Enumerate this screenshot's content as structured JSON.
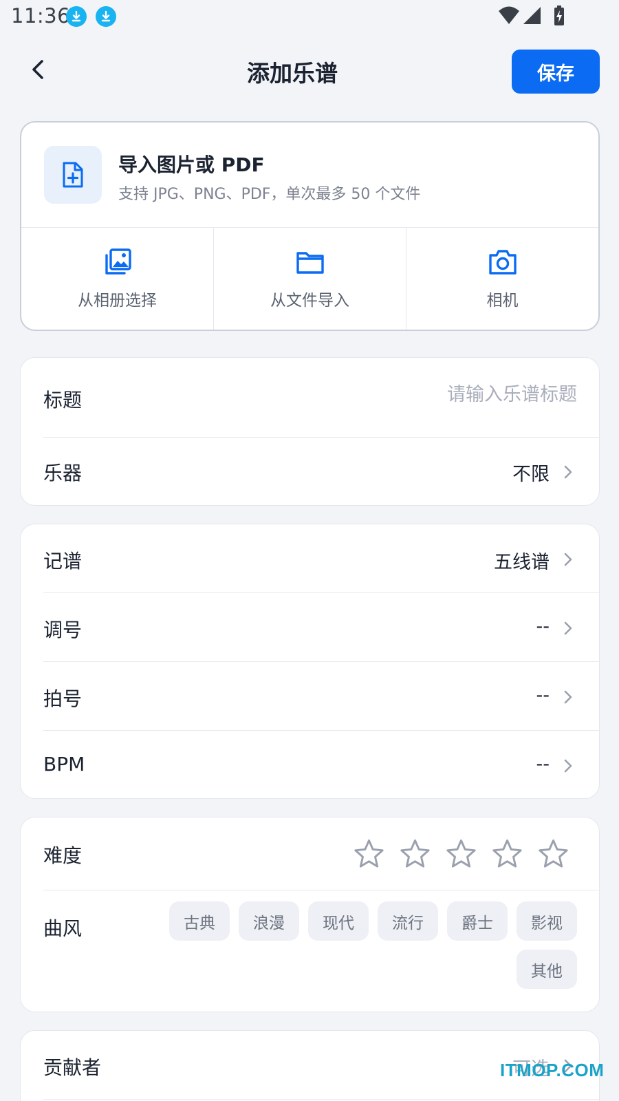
{
  "status_bar": {
    "time": "11:36"
  },
  "header": {
    "title": "添加乐谱",
    "save_label": "保存"
  },
  "import": {
    "title": "导入图片或 PDF",
    "subtitle": "支持 JPG、PNG、PDF，单次最多 50 个文件",
    "actions": [
      {
        "label": "从相册选择",
        "icon": "gallery-icon"
      },
      {
        "label": "从文件导入",
        "icon": "folder-icon"
      },
      {
        "label": "相机",
        "icon": "camera-icon"
      }
    ]
  },
  "basic": {
    "title_label": "标题",
    "title_placeholder": "请输入乐谱标题",
    "instrument_label": "乐器",
    "instrument_value": "不限"
  },
  "notation": {
    "notation_label": "记谱",
    "notation_value": "五线谱",
    "key_label": "调号",
    "key_value": "--",
    "time_sig_label": "拍号",
    "time_sig_value": "--",
    "bpm_label": "BPM",
    "bpm_value": "--"
  },
  "style": {
    "difficulty_label": "难度",
    "difficulty_rating": 0,
    "difficulty_max": 5,
    "genre_label": "曲风",
    "genres": [
      "古典",
      "浪漫",
      "现代",
      "流行",
      "爵士",
      "影视",
      "其他"
    ]
  },
  "contributor": {
    "label": "贡献者",
    "value": "可选"
  },
  "watermark": "ITMOP.COM",
  "colors": {
    "accent": "#0b6bf2",
    "background": "#f2f4f8",
    "muted_text": "#a9aebb"
  }
}
